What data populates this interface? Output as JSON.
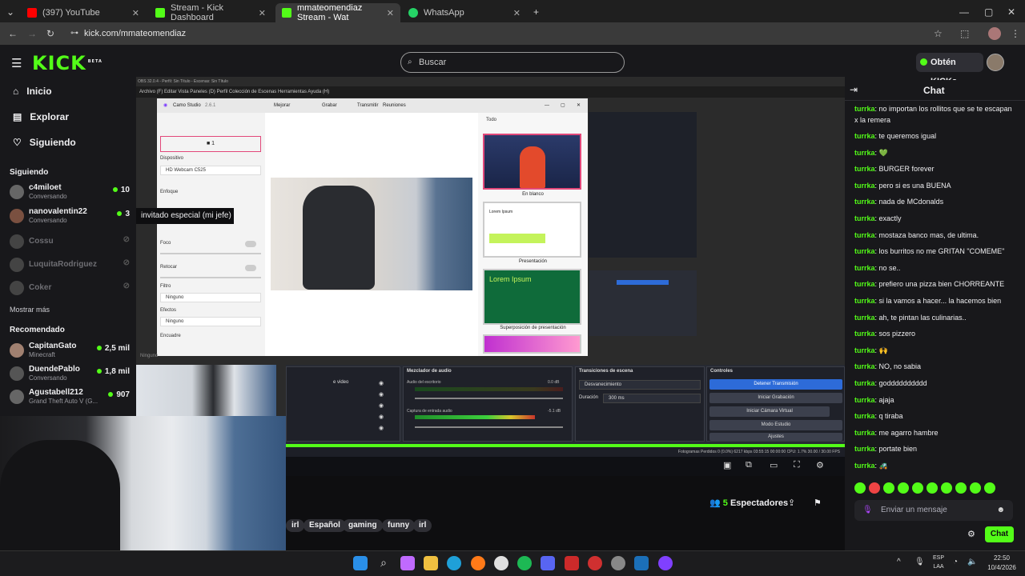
{
  "browser": {
    "tabs": [
      {
        "label": "(397) YouTube",
        "color": "#ff0000"
      },
      {
        "label": "Stream - Kick Dashboard",
        "color": "#53fc18"
      },
      {
        "label": "mmateomendiaz Stream - Wat",
        "color": "#53fc18"
      },
      {
        "label": "WhatsApp",
        "color": "#25d366"
      }
    ],
    "address": "kick.com/mmateomendiaz"
  },
  "header": {
    "logo": "KICK",
    "logo_badge": "BETA",
    "search_placeholder": "Buscar",
    "kicks_button": "Obtén KICKs"
  },
  "sidebar": {
    "nav": [
      "Inicio",
      "Explorar",
      "Siguiendo"
    ],
    "following_title": "Siguiendo",
    "following": [
      {
        "name": "c4miloet",
        "status": "Conversando",
        "viewers": "10"
      },
      {
        "name": "nanovalentin22",
        "status": "Conversando",
        "viewers": "3"
      },
      {
        "name": "Cossu",
        "status": "",
        "viewers": ""
      },
      {
        "name": "LuquitaRodriguez",
        "status": "",
        "viewers": ""
      },
      {
        "name": "Coker",
        "status": "",
        "viewers": ""
      }
    ],
    "show_more": "Mostrar más",
    "recommended_title": "Recomendado",
    "recommended": [
      {
        "name": "CapitanGato",
        "status": "Minecraft",
        "viewers": "2,5 mil"
      },
      {
        "name": "DuendePablo",
        "status": "Conversando",
        "viewers": "1,8 mil"
      },
      {
        "name": "Agustabell212",
        "status": "Grand Theft Auto V (G...",
        "viewers": "907"
      }
    ]
  },
  "stream": {
    "tooltip": "invitado especial (mi jefe)",
    "obs_title": "OBS 32.0.4 - Perfil: Sin Título - Escenas: Sin Título",
    "obs_menu": "Archivo (F)   Editar   Vista   Paneles (D)   Perfil   Colección de Escenas   Herramientas   Ayuda (H)",
    "camo": {
      "title": "Camo Studio",
      "version": "2.6.1",
      "tabs": [
        "Mejorar",
        "Grabar",
        "Transmitir",
        "Reuniones"
      ],
      "camera_count": "1",
      "device_label": "Dispositivo",
      "device_value": "HD Webcam C525",
      "focus_label": "Enfoque",
      "foco_label": "Foco",
      "retocar_label": "Retocar",
      "filtro_label": "Filtro",
      "filtro_value": "Ninguno",
      "efectos_label": "Efectos",
      "efectos_value": "Ninguno",
      "encuadre_label": "Encuadre",
      "overlay_filter": "Todo",
      "overlays": [
        "En blanco",
        "Presentación",
        "Superposición de presentación"
      ],
      "overlay_text": "Lorem Ipsum"
    },
    "obs": {
      "mixer_title": "Mezclador de audio",
      "mixer_tracks": [
        "Audio del escritorio",
        "Captura de entrada audio"
      ],
      "mixer_db": [
        "0.0 dB",
        "-5.1 dB"
      ],
      "transitions_title": "Transiciones de escena",
      "transition_value": "Desvanecimiento",
      "duration_label": "Duración",
      "duration_value": "300 ms",
      "controls_title": "Controles",
      "controls": [
        "Detener Transmisión",
        "Iniciar Grabación",
        "Iniciar Cámara Virtual",
        "Modo Estudio",
        "Ajustes"
      ],
      "sources_item": "e video",
      "status": "Fotogramas Perdidos 0 (0.0%)   6217 kbps   03:55:15   00:00:00   CPU: 1.7%   30.00 / 30.00 FPS"
    },
    "bottom_label": "Ninguno"
  },
  "below": {
    "spectators_count": "5",
    "spectators_label": "Espectadores",
    "tags": [
      "irl",
      "Español",
      "gaming",
      "funny",
      "irl"
    ]
  },
  "chat": {
    "title": "Chat",
    "messages": [
      {
        "user": "turrka",
        "text": "no importan los rollitos que se te escapan x la remera"
      },
      {
        "user": "turrka",
        "text": "te queremos igual"
      },
      {
        "user": "turrka",
        "text": "💚"
      },
      {
        "user": "turrka",
        "text": "BURGER forever"
      },
      {
        "user": "turrka",
        "text": "pero si es una BUENA"
      },
      {
        "user": "turrka",
        "text": "nada de MCdonalds"
      },
      {
        "user": "turrka",
        "text": "exactly"
      },
      {
        "user": "turrka",
        "text": "mostaza banco mas, de ultima."
      },
      {
        "user": "turrka",
        "text": "los burritos no me GRITAN \"COMEME\""
      },
      {
        "user": "turrka",
        "text": "no se.."
      },
      {
        "user": "turrka",
        "text": "prefiero una pizza bien CHORREANTE"
      },
      {
        "user": "turrka",
        "text": "si la vamos a hacer... la hacemos bien"
      },
      {
        "user": "turrka",
        "text": "ah, te pintan las culinarias.."
      },
      {
        "user": "turrka",
        "text": "sos pizzero"
      },
      {
        "user": "turrka",
        "text": "🙌"
      },
      {
        "user": "turrka",
        "text": "NO, no sabia"
      },
      {
        "user": "turrka",
        "text": "godddddddddd"
      },
      {
        "user": "turrka",
        "text": "ajaja"
      },
      {
        "user": "turrka",
        "text": "q tiraba"
      },
      {
        "user": "turrka",
        "text": "me agarro hambre"
      },
      {
        "user": "turrka",
        "text": "portate bien"
      },
      {
        "user": "turrka",
        "text": "🚜"
      }
    ],
    "input_placeholder": "Enviar un mensaje",
    "send_button": "Chat"
  },
  "taskbar": {
    "lang_1": "ESP",
    "lang_2": "LAA",
    "time": "22:50",
    "date": "10/4/2026"
  },
  "colors": {
    "accent": "#53fc18",
    "bg": "#0e0e10",
    "panel": "#18181b"
  }
}
